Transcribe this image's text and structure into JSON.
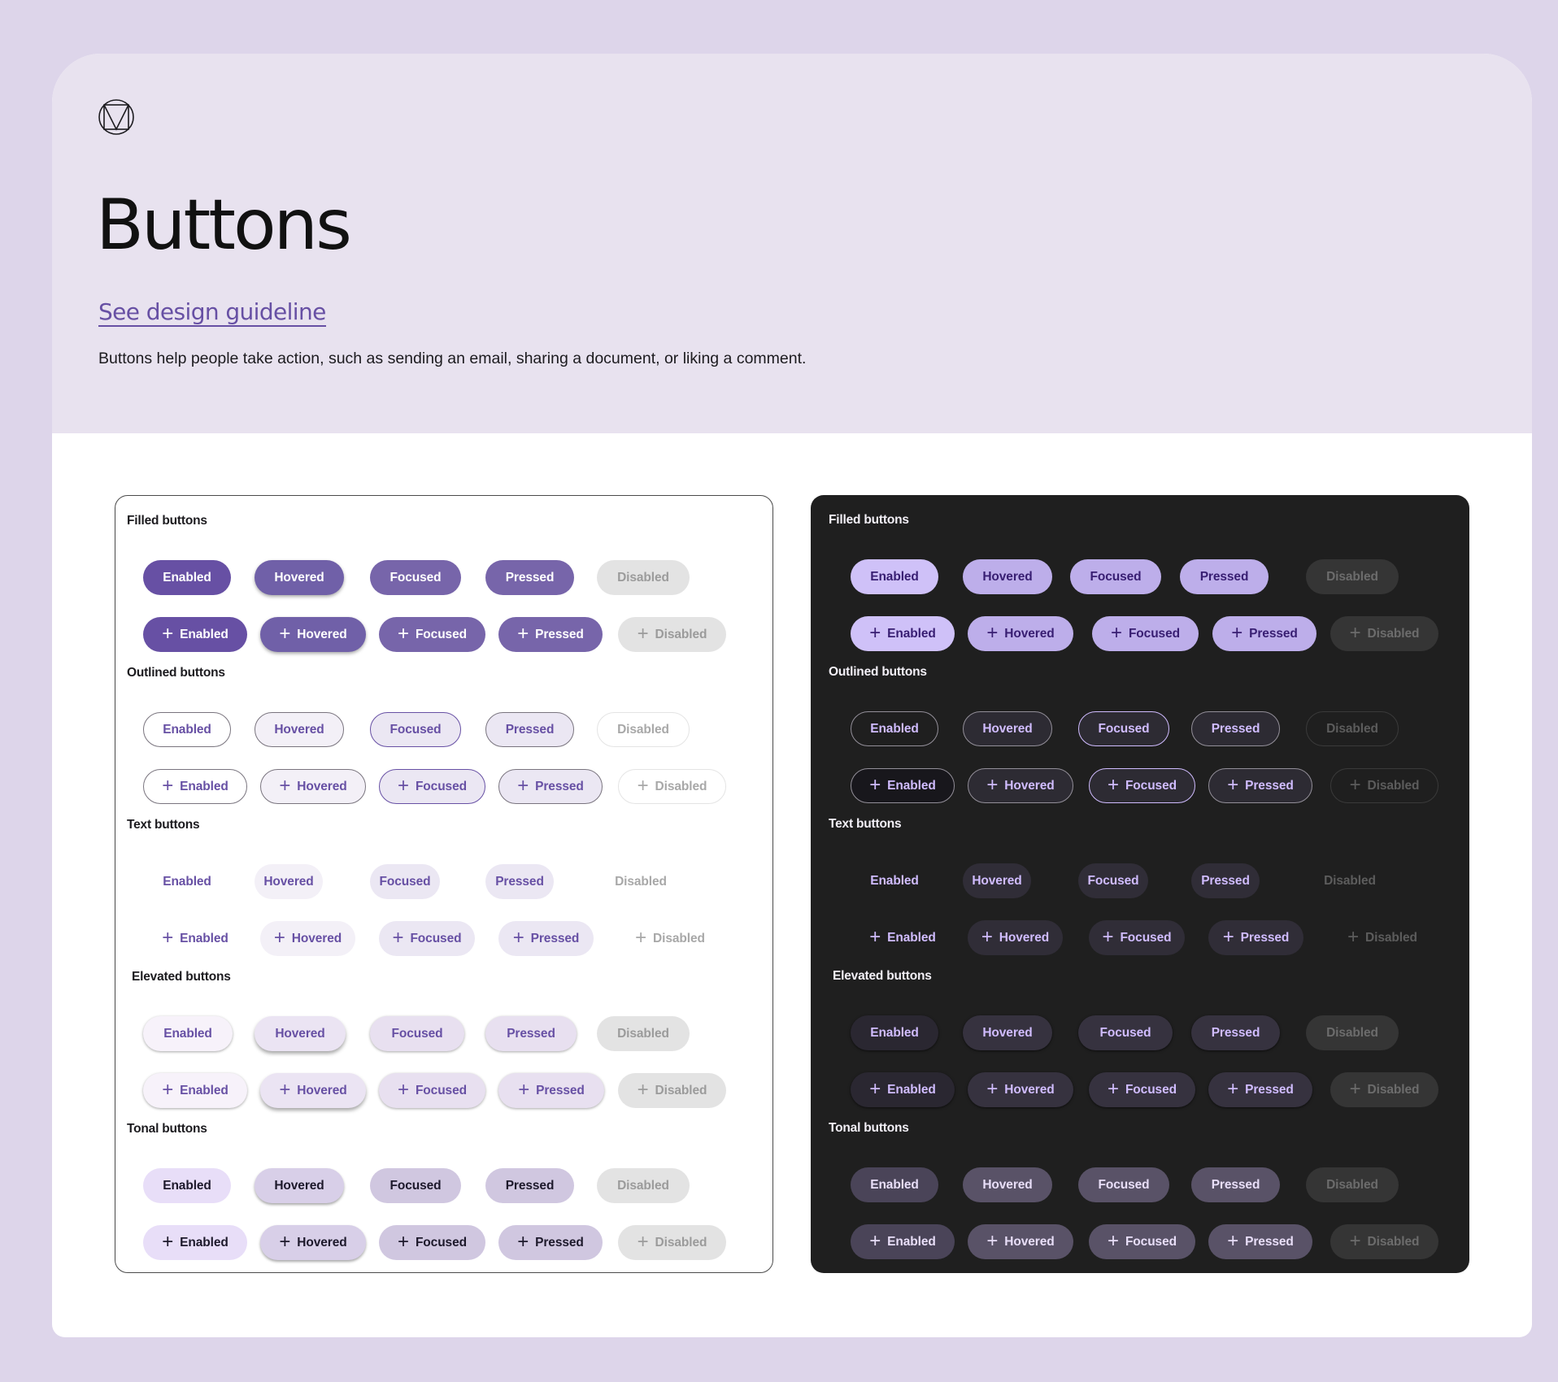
{
  "header": {
    "logo_icon": "material-logo-icon",
    "title": "Buttons",
    "guideline_link": "See design guideline",
    "description": "Buttons help people take action, such as sending an email, sharing a document, or liking a comment."
  },
  "states": [
    "Enabled",
    "Hovered",
    "Focused",
    "Pressed",
    "Disabled"
  ],
  "icon": {
    "name": "plus-icon",
    "glyph": "+"
  },
  "panels": [
    {
      "theme": "light",
      "sections": [
        {
          "type": "filled",
          "label": "Filled buttons"
        },
        {
          "type": "outlined",
          "label": "Outlined buttons"
        },
        {
          "type": "text",
          "label": "Text buttons"
        },
        {
          "type": "elevated",
          "label": "Elevated buttons"
        },
        {
          "type": "tonal",
          "label": "Tonal buttons"
        }
      ]
    },
    {
      "theme": "dark",
      "sections": [
        {
          "type": "filled",
          "label": "Filled buttons"
        },
        {
          "type": "outlined",
          "label": "Outlined buttons"
        },
        {
          "type": "text",
          "label": "Text buttons"
        },
        {
          "type": "elevated",
          "label": "Elevated buttons"
        },
        {
          "type": "tonal",
          "label": "Tonal buttons"
        }
      ]
    }
  ],
  "colors": {
    "page_background": "#ddd5ea",
    "hero_background": "#e8e2ef",
    "primary_light": "#6750a4",
    "primary_dark": "#d0bcff",
    "dark_panel_background": "#1f1f1f"
  }
}
